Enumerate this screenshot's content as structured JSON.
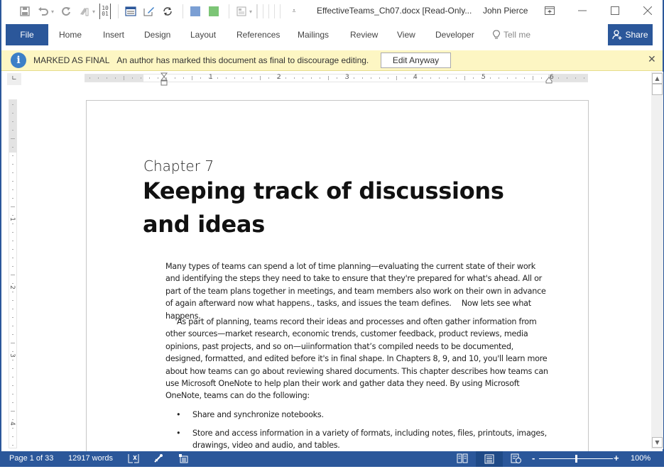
{
  "title_bar": {
    "document_title": "EffectiveTeams_Ch07.docx [Read-Only...",
    "user_name": "John Pierce",
    "quick_access": [
      "save-icon",
      "undo-icon",
      "redo-icon",
      "format-painter-icon",
      "binary-icon",
      "display-icon",
      "edit-icon",
      "refresh-icon",
      "blue-color-swatch",
      "green-color-swatch",
      "layout-icon",
      "customize-icon"
    ],
    "colors": {
      "swatch_blue": "#7b9fd4",
      "swatch_green": "#7cc576"
    }
  },
  "ribbon": {
    "file_label": "File",
    "tabs": [
      "Home",
      "Insert",
      "Design",
      "Layout",
      "References",
      "Mailings",
      "Review",
      "View",
      "Developer"
    ],
    "tell_me": "Tell me",
    "share_label": "Share",
    "accent_color": "#2b579a"
  },
  "message_bar": {
    "title": "MARKED AS FINAL",
    "text": "An author has marked this document as final to discourage editing.",
    "button_label": "Edit Anyway",
    "close_glyph": "✕"
  },
  "ruler": {
    "corner_glyph": "∟",
    "h_numbers": [
      "1",
      "2",
      "3",
      "4",
      "5",
      "6"
    ],
    "v_numbers": [
      "1",
      "2",
      "3",
      "4"
    ]
  },
  "document": {
    "chapter_label": "Chapter 7",
    "heading": "Keeping track of discussions and ideas",
    "paragraphs": [
      "Many types of teams can spend a lot of time planning—evaluating the current state of their work and identifying the steps they need to take to ensure that they're prepared for what's ahead. All or part of the team plans together in meetings, and team members also work on their own in advance of again afterward now what happens., tasks, and issues the team defines.  Now lets see what happens.",
      "As part of planning, teams record their ideas and processes and often gather information from other sources—market research, economic trends, customer feedback, product reviews, media opinions, past projects, and so on—uiinformation that’s compiled needs to be documented, designed, formatted, and edited before it's in final shape. In Chapters 8, 9, and 10, you'll learn more about how teams can go about reviewing shared documents. This chapter describes how teams can use Microsoft OneNote to help plan their work and gather data they need. By using Microsoft OneNote, teams can do the following:"
    ],
    "bullets": [
      "Share and synchronize notebooks.",
      "Store and access information in a variety of formats, including notes, files, printouts, images, drawings, video and audio, and tables."
    ],
    "bullet_glyph": "•"
  },
  "status_bar": {
    "page_info": "Page 1 of 33",
    "word_count": "12917 words",
    "zoom_minus": "-",
    "zoom_plus": "+",
    "zoom_level": "100%",
    "zoom_percent": 100
  }
}
